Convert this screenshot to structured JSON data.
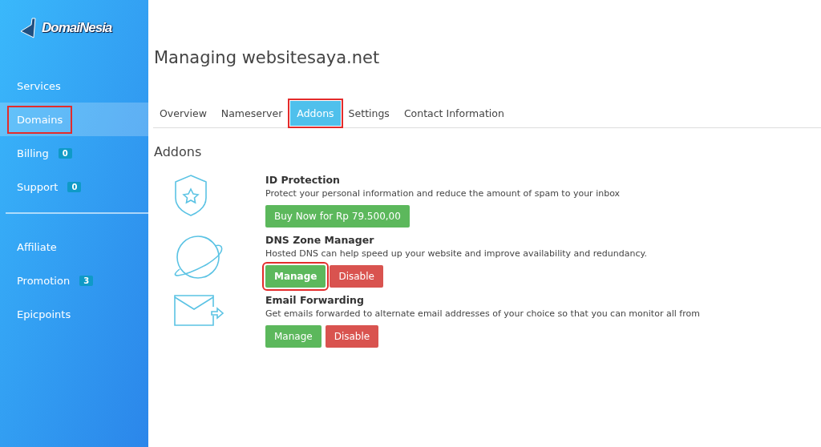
{
  "sidebar": {
    "logo": "DomaiNesia",
    "items": [
      {
        "label": "Services",
        "selected": false,
        "highlighted": false
      },
      {
        "label": "Domains",
        "selected": true,
        "highlighted": true
      },
      {
        "label": "Billing",
        "badge": "0",
        "selected": false,
        "highlighted": false
      },
      {
        "label": "Support",
        "badge": "0",
        "selected": false,
        "highlighted": false
      },
      {
        "kind": "divider"
      },
      {
        "label": "Affiliate",
        "selected": false,
        "highlighted": false
      },
      {
        "label": "Promotion",
        "badge": "3",
        "selected": false,
        "highlighted": false
      },
      {
        "label": "Epicpoints",
        "selected": false,
        "highlighted": false
      }
    ]
  },
  "title": "Managing websitesaya.net",
  "tabs": [
    {
      "label": "Overview",
      "selected": false,
      "highlighted": false
    },
    {
      "label": "Nameserver",
      "selected": false,
      "highlighted": false
    },
    {
      "label": "Addons",
      "selected": true,
      "highlighted": true
    },
    {
      "label": "Settings",
      "selected": false,
      "highlighted": false
    },
    {
      "label": "Contact Information",
      "selected": false,
      "highlighted": false
    }
  ],
  "section_title": "Addons",
  "addons": [
    {
      "kind": "shield",
      "name": "ID Protection",
      "description": "Protect your personal information and reduce the amount of spam to your inbox",
      "buttons": [
        {
          "label": "Buy Now for Rp 79.500,00",
          "kind": "success",
          "highlighted": false
        }
      ]
    },
    {
      "kind": "planet",
      "name": "DNS Zone Manager",
      "description": "Hosted DNS can help speed up your website and improve availability and redundancy.",
      "buttons": [
        {
          "label": "Manage",
          "kind": "success",
          "highlighted": true
        },
        {
          "label": "Disable",
          "kind": "danger",
          "highlighted": false
        }
      ]
    },
    {
      "kind": "mail",
      "name": "Email Forwarding",
      "description": "Get emails forwarded to alternate email addresses of your choice so that you can monitor all from",
      "buttons": [
        {
          "label": "Manage",
          "kind": "success",
          "highlighted": false
        },
        {
          "label": "Disable",
          "kind": "danger",
          "highlighted": false
        }
      ]
    }
  ]
}
